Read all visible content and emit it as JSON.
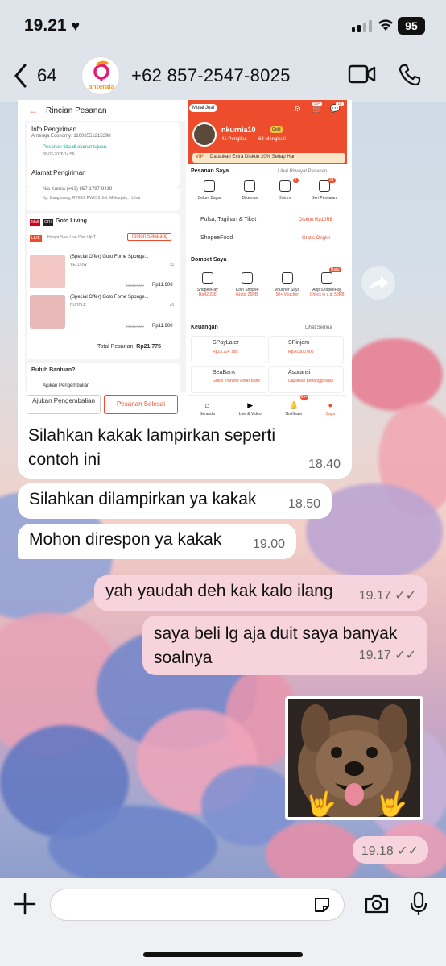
{
  "status": {
    "time": "19.21",
    "battery": "95"
  },
  "header": {
    "back_count": "64",
    "avatar_logo": "anteraja",
    "contact": "+62 857-2547-8025"
  },
  "shot": {
    "left": {
      "title": "Rincian Pesanan",
      "info_title": "Info Pengiriman",
      "courier": "Anteraja Economy: 11003551215398",
      "delivered": "Pesanan tiba di alamat tujuan.",
      "delivered_date": "30-03-2026 14:56",
      "address_title": "Alamat Pengiriman",
      "recipient": "Nia Kurnia (+62) 857-1797-9419",
      "address": "Kp. Bangkuang, RT003/ RW010, kel. Mekarjati,... Lihat",
      "mall_badge": "Mall",
      "ori_badge": "ORI",
      "shop": "Goto Living",
      "live_badge": "LIVE",
      "live_text": "Hanya Saat Live Disc Up T...",
      "watch_btn": "Tonton Sekarang",
      "items": [
        {
          "name": "(Special Offer) Goto Fome Sponge...",
          "variant": "YELLOW",
          "qty": "x1",
          "old": "Rp21.600",
          "price": "Rp11.900"
        },
        {
          "name": "(Special Offer) Goto Fome Sponge...",
          "variant": "PURPLE",
          "qty": "x1",
          "old": "Rp21.600",
          "price": "Rp11.900"
        }
      ],
      "total_label": "Total Pesanan:",
      "total": "Rp21.775",
      "help_title": "Butuh Bantuan?",
      "help_item": "Ajukan Pengembalian",
      "btn_return": "Ajukan Pengembalian",
      "btn_done": "Pesanan Selesai"
    },
    "right": {
      "sell": "Mulai Jual",
      "badge_count": "99+",
      "badge_count2": "18",
      "username": "nkurnia10",
      "tier": "Gold",
      "followers": "41 Pengikut",
      "following": "68 Mengikuti",
      "vip": "VIP",
      "vip_text": "Dapatkan Extra Diskon 20% Setiap Hari",
      "orders_title": "Pesanan Saya",
      "orders_link": "Lihat Riwayat Pesanan",
      "order_tabs": [
        "Belum Bayar",
        "Dikemas",
        "Dikirim",
        "Beri Penilaian"
      ],
      "order_badges": [
        "",
        "",
        "4",
        "21"
      ],
      "pulsa": "Pulsa, Tagihan & Tiket",
      "pulsa_promo": "Diskon Rp10RB",
      "food": "ShopeeFood",
      "food_promo": "Gratis Ongkir",
      "wallet_title": "Dompet Saya",
      "baru": "Baru",
      "wallet": [
        {
          "name": "ShopeePay",
          "sub": "Rp42.235"
        },
        {
          "name": "Koin Shopee",
          "sub": "Gratis 25RB!"
        },
        {
          "name": "Voucher Saya",
          "sub": "50+ Voucher"
        },
        {
          "name": "App ShopeePay",
          "sub": "Check in s.d. 50RB"
        }
      ],
      "finance_title": "Keuangan",
      "finance_link": "Lihat Semua",
      "finance": [
        {
          "name": "SPayLater",
          "sub": "Rp23.224.785"
        },
        {
          "name": "SPinjam",
          "sub": "Rp26.300.000"
        },
        {
          "name": "SeaBank",
          "sub": "Gratis Transfer Antar Bank"
        },
        {
          "name": "Asuransi",
          "sub": "Dapatkan pertanggungan"
        }
      ],
      "notif_badge": "99+",
      "nav": [
        "Beranda",
        "Live & Video",
        "Notifikasi",
        "Saya"
      ]
    }
  },
  "messages": {
    "caption": "Silahkan kakak lampirkan seperti contoh ini",
    "caption_time": "18.40",
    "m1": "Silahkan dilampirkan ya kakak",
    "m1_time": "18.50",
    "m2": "Mohon direspon ya kakak",
    "m2_time": "19.00",
    "m3": "yah yaudah deh kak kalo ilang",
    "m3_time": "19.17",
    "m4": "saya beli lg aja duit saya banyak soalnya",
    "m4_time": "19.17",
    "m5_time": "19.18"
  },
  "colors": {
    "shopee": "#ee4d2d",
    "outgoing": "#f7d3dd"
  }
}
